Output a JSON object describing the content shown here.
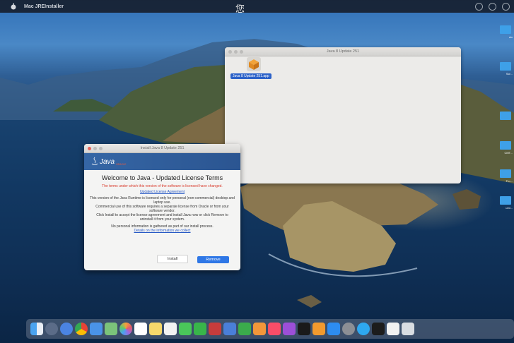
{
  "menubar": {
    "app_name": "Mac JREInstaller",
    "center_glyph": "您"
  },
  "finder_window": {
    "title": "Java 8 Update 251",
    "file_label": "Java 8 Update 251.app"
  },
  "java_window": {
    "title": "Install Java 8 Update 251",
    "logo_text": "Java",
    "logo_subtext": "ORACLE",
    "heading": "Welcome to Java - Updated License Terms",
    "warning": "The terms under which this version of the software is licensed have changed.",
    "license_link": "Updated License Agreement",
    "para1": "This version of the Java Runtime is licensed only for personal (non-commercial) desktop and laptop use.",
    "para2": "Commercial use of this software requires a separate license from Oracle or from your software vendor.",
    "para3": "Click Install to accept the license agreement and install Java now or click Remove to uninstall it from your system.",
    "para4": "No personal information is gathered as part of our install process.",
    "details_link": "Details on the information we collect",
    "install_label": "Install",
    "remove_label": "Remove"
  },
  "desktop_labels": [
    "ctx",
    "Scr...",
    "CMT...",
    "Fro...",
    "uml..."
  ],
  "dock_icons": [
    "finder-icon",
    "launchpad-icon",
    "safari-icon",
    "chrome-icon",
    "mail-icon",
    "maps-icon",
    "photos-icon",
    "calendar-icon",
    "notes-icon",
    "reminders-icon",
    "messages-icon",
    "facetime-icon",
    "photo-booth-icon",
    "keynote-icon",
    "numbers-icon",
    "pages-icon",
    "music-icon",
    "podcasts-icon",
    "tv-icon",
    "books-icon",
    "app-store-icon",
    "system-preferences-icon",
    "qq-icon",
    "terminal-icon",
    "documents-icon",
    "trash-icon"
  ],
  "colors": {
    "java_blue": "#3566a5",
    "warning_red": "#d93a2b",
    "link_blue": "#2557c4",
    "primary_button": "#2f77e6"
  }
}
